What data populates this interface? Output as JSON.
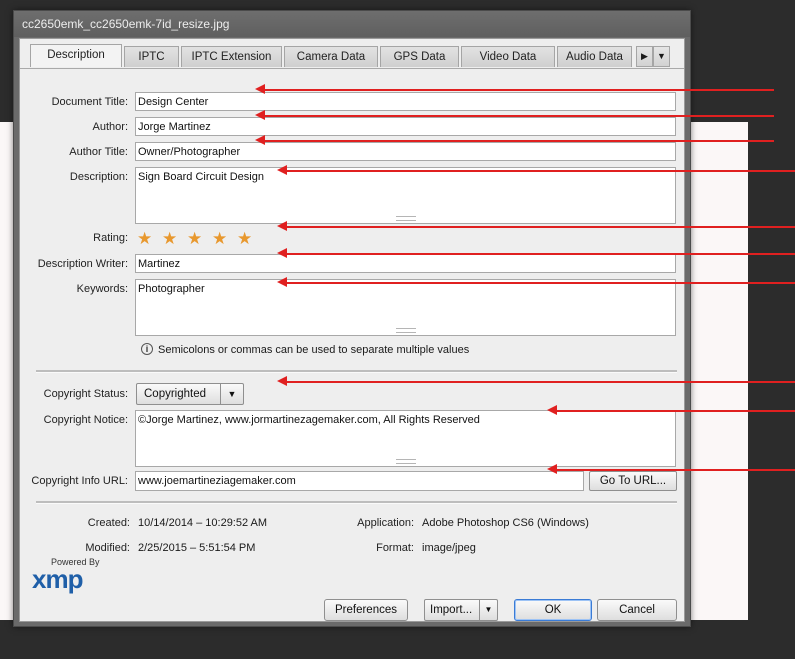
{
  "window": {
    "title": "cc2650emk_cc2650emk-7id_resize.jpg"
  },
  "tabs": [
    "Description",
    "IPTC",
    "IPTC Extension",
    "Camera Data",
    "GPS Data",
    "Video Data",
    "Audio Data"
  ],
  "tab_icons": {
    "next": "triangle-right-icon",
    "menu": "triangle-down-icon"
  },
  "fields": {
    "document_title": {
      "label": "Document Title:",
      "value": "Design Center"
    },
    "author": {
      "label": "Author:",
      "value": "Jorge Martinez"
    },
    "author_title": {
      "label": "Author Title:",
      "value": "Owner/Photographer"
    },
    "description": {
      "label": "Description:",
      "value": "Sign Board Circuit Design"
    },
    "rating": {
      "label": "Rating:",
      "stars": 5
    },
    "description_writer": {
      "label": "Description Writer:",
      "value": "Martinez"
    },
    "keywords": {
      "label": "Keywords:",
      "value": "Photographer"
    },
    "hint": "Semicolons or commas can be used to separate multiple values",
    "copyright_status": {
      "label": "Copyright Status:",
      "value": "Copyrighted"
    },
    "copyright_notice": {
      "label": "Copyright Notice:",
      "value": "©Jorge Martinez, www.jormartinezagemaker.com, All Rights Reserved"
    },
    "copyright_url": {
      "label": "Copyright Info URL:",
      "value": "www.joemartineziagemaker.com",
      "button": "Go To URL..."
    }
  },
  "meta": {
    "created_label": "Created:",
    "created": "10/14/2014 – 10:29:52 AM",
    "modified_label": "Modified:",
    "modified": "2/25/2015 – 5:51:54 PM",
    "application_label": "Application:",
    "application": "Adobe Photoshop CS6 (Windows)",
    "format_label": "Format:",
    "format": "image/jpeg"
  },
  "footer": {
    "powered_by": "Powered By",
    "logo": "xmp",
    "preferences": "Preferences",
    "import": "Import...",
    "ok": "OK",
    "cancel": "Cancel"
  },
  "colors": {
    "annotation_arrow": "#e02020",
    "star": "#e8982e",
    "xmp_logo": "#1f5fa8"
  }
}
